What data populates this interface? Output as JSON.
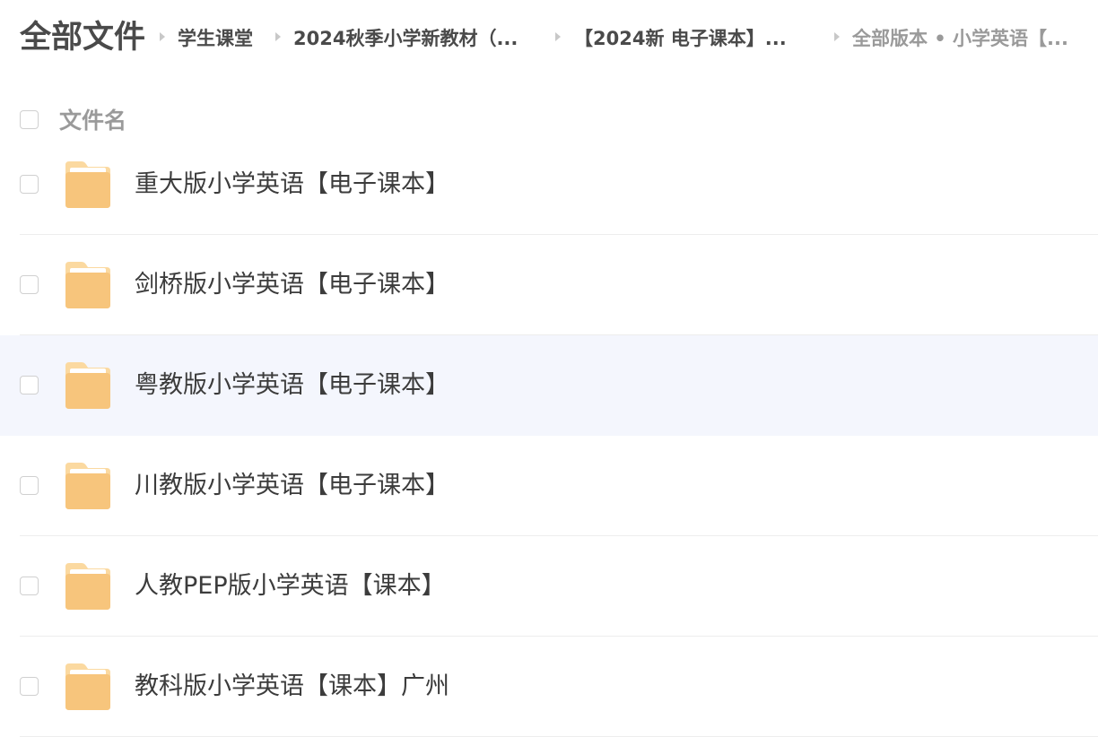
{
  "breadcrumb": {
    "root": "全部文件",
    "items": [
      "学生课堂",
      "2024秋季小学新教材（...",
      "【2024新 电子课本】...",
      "全部版本 • 小学英语【..."
    ]
  },
  "list_header": {
    "label": "文件名"
  },
  "files": [
    {
      "name": "重大版小学英语【电子课本】",
      "icon": "folder-icon"
    },
    {
      "name": "剑桥版小学英语【电子课本】",
      "icon": "folder-icon"
    },
    {
      "name": "粤教版小学英语【电子课本】",
      "icon": "folder-icon"
    },
    {
      "name": "川教版小学英语【电子课本】",
      "icon": "folder-icon"
    },
    {
      "name": "人教PEP版小学英语【课本】",
      "icon": "folder-icon"
    },
    {
      "name": "教科版小学英语【课本】广州",
      "icon": "folder-icon"
    }
  ],
  "colors": {
    "folder_body": "#f7c57c",
    "folder_back": "#fbd9a0",
    "folder_paper": "#ffffff",
    "hover_row": "#f4f6fd"
  }
}
